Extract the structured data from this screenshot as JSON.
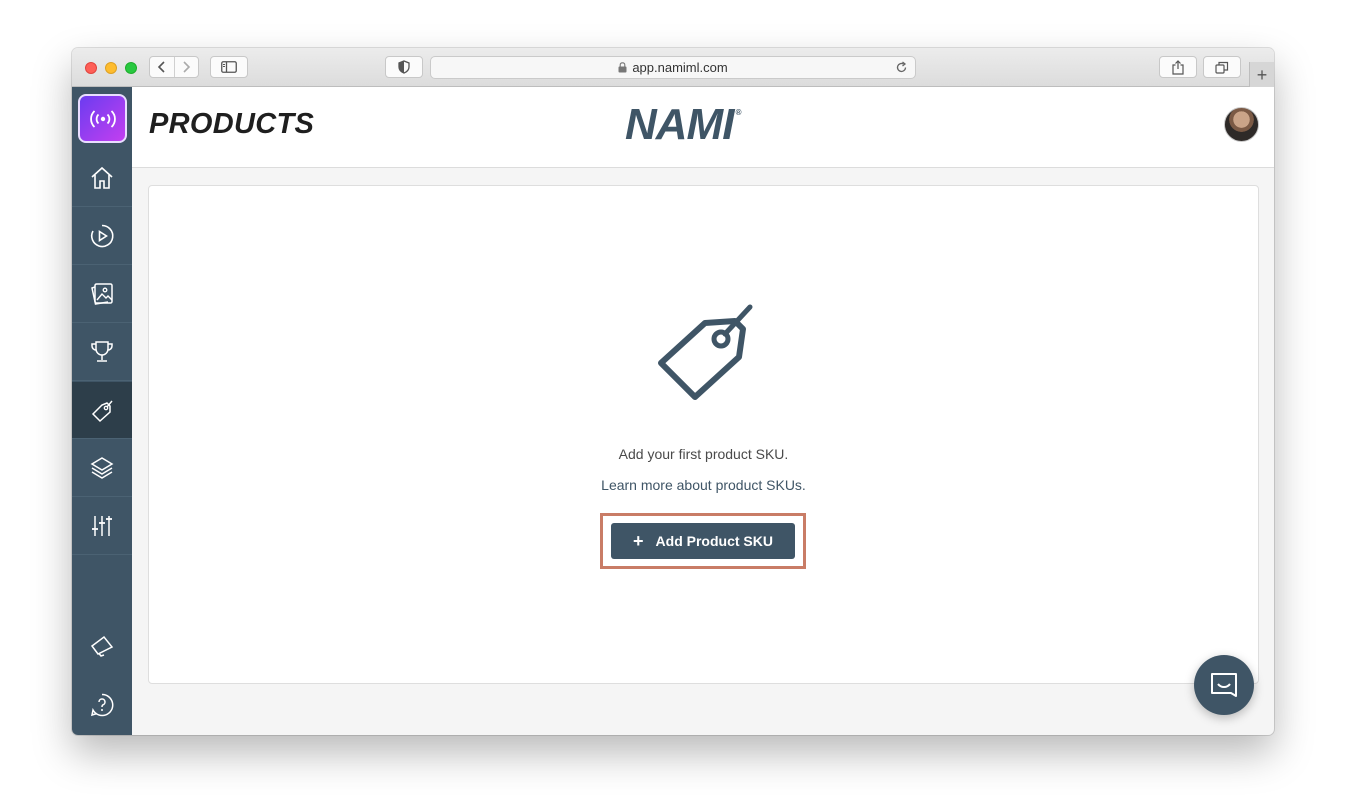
{
  "browser": {
    "url": "app.namiml.com",
    "new_tab_label": "+"
  },
  "header": {
    "page_title": "PRODUCTS",
    "brand": "NAMI",
    "brand_mark": "®"
  },
  "sidebar": {
    "items": [
      {
        "name": "home",
        "icon": "home-icon"
      },
      {
        "name": "campaigns",
        "icon": "play-circle-icon"
      },
      {
        "name": "paywalls",
        "icon": "image-gallery-icon"
      },
      {
        "name": "entitlements",
        "icon": "trophy-icon"
      },
      {
        "name": "products",
        "icon": "tag-icon",
        "active": true
      },
      {
        "name": "layers",
        "icon": "layers-icon"
      },
      {
        "name": "settings",
        "icon": "sliders-icon"
      },
      {
        "name": "announcements",
        "icon": "megaphone-icon"
      },
      {
        "name": "help",
        "icon": "help-circle-icon"
      }
    ]
  },
  "empty_state": {
    "title": "Add your first product SKU.",
    "link": "Learn more about product SKUs.",
    "button_label": "Add Product SKU",
    "button_icon": "+"
  },
  "colors": {
    "sidebar": "#3f5566",
    "sidebar_active": "#2d3e4a",
    "primary": "#3f5566",
    "highlight": "#c97c66",
    "logo_gradient_start": "#6b3cf0",
    "logo_gradient_end": "#c33ff0"
  }
}
